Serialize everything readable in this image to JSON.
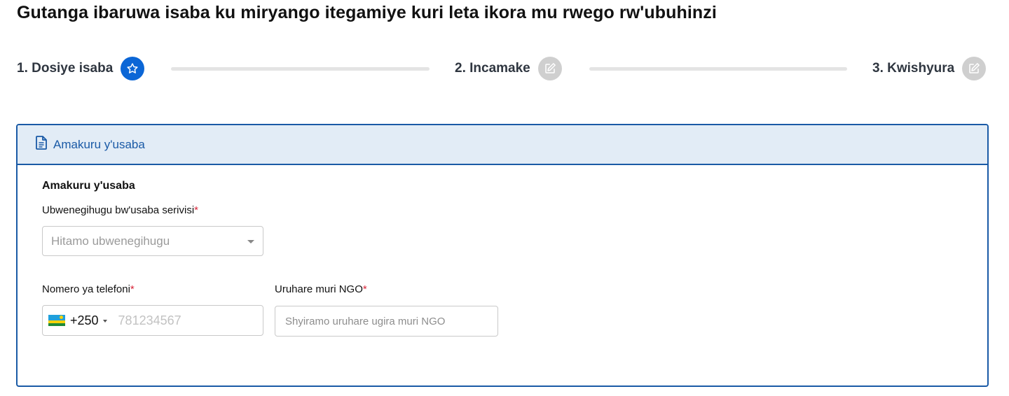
{
  "page": {
    "title": "Gutanga ibaruwa isaba ku miryango itegamiye kuri leta ikora mu rwego rw'ubuhinzi"
  },
  "stepper": {
    "steps": [
      {
        "label": "1. Dosiye isaba",
        "icon": "star-icon",
        "state": "active"
      },
      {
        "label": "2. Incamake",
        "icon": "edit-icon",
        "state": "inactive"
      },
      {
        "label": "3. Kwishyura",
        "icon": "edit-icon",
        "state": "inactive"
      }
    ]
  },
  "card": {
    "header_title": "Amakuru y'usaba",
    "header_icon": "document-icon",
    "section_title": "Amakuru y'usaba",
    "nationality": {
      "label": "Ubwenegihugu bw'usaba serivisi",
      "required_mark": "*",
      "placeholder": "Hitamo ubwenegihugu"
    },
    "phone": {
      "label": "Nomero ya telefoni",
      "required_mark": "*",
      "dial_code": "+250",
      "placeholder": "781234567",
      "flag_icon": "rwanda-flag-icon"
    },
    "ngo_role": {
      "label": "Uruhare muri NGO",
      "required_mark": "*",
      "placeholder": "Shyiramo uruhare ugira muri NGO"
    }
  },
  "colors": {
    "accent": "#0b66d6",
    "border": "#1a5aa6",
    "header_bg": "#e2ecf6",
    "required": "#d8263a",
    "inactive_step": "#cfcfcf"
  }
}
